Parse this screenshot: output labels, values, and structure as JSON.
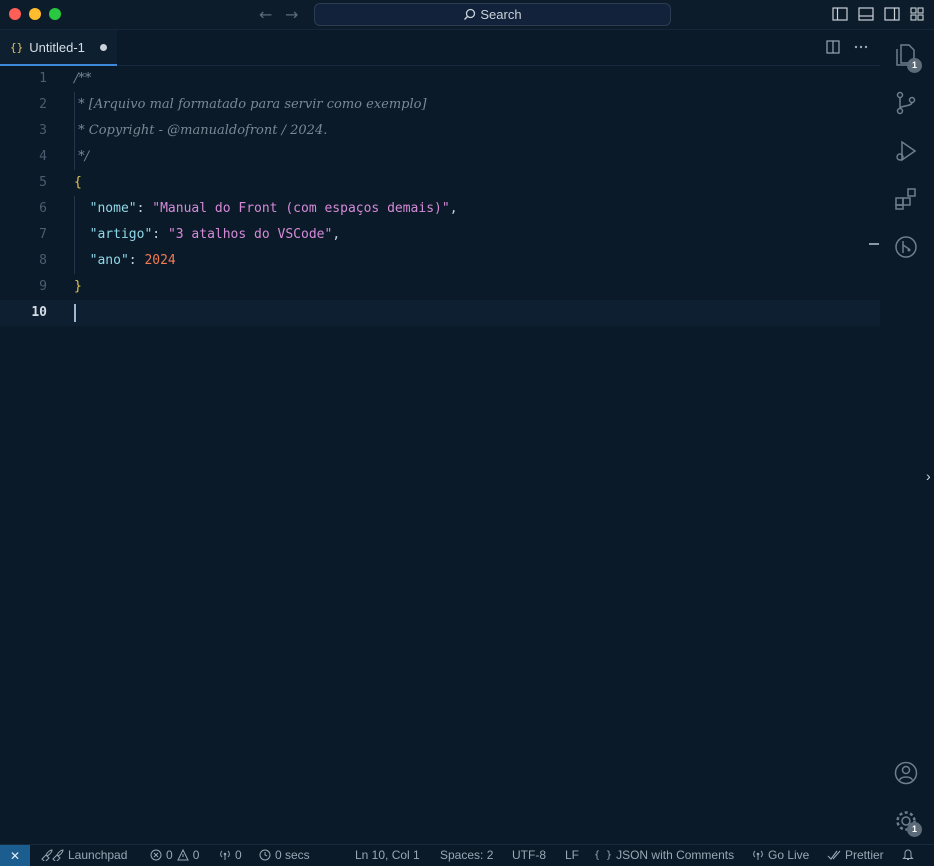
{
  "window": {
    "search_label": "Search"
  },
  "tabs": [
    {
      "icon": "{}",
      "label": "Untitled-1",
      "modified": true
    }
  ],
  "editor": {
    "lines": [
      {
        "number": "1",
        "tokens": [
          {
            "t": "comment",
            "v": "/**"
          }
        ]
      },
      {
        "number": "2",
        "tokens": [
          {
            "t": "comment",
            "v": " * [Arquivo mal formatado para servir como exemplo]"
          }
        ]
      },
      {
        "number": "3",
        "tokens": [
          {
            "t": "comment",
            "v": " * Copyright - @manualdofront / 2024."
          }
        ]
      },
      {
        "number": "4",
        "tokens": [
          {
            "t": "comment",
            "v": " */"
          }
        ]
      },
      {
        "number": "5",
        "tokens": [
          {
            "t": "brace",
            "v": "{"
          }
        ]
      },
      {
        "number": "6",
        "tokens": [
          {
            "t": "punct",
            "v": "  "
          },
          {
            "t": "key",
            "v": "\"nome\""
          },
          {
            "t": "punct",
            "v": ": "
          },
          {
            "t": "string",
            "v": "\"Manual do Front (com espaços demais)\""
          },
          {
            "t": "punct",
            "v": ","
          }
        ]
      },
      {
        "number": "7",
        "tokens": [
          {
            "t": "punct",
            "v": "  "
          },
          {
            "t": "key",
            "v": "\"artigo\""
          },
          {
            "t": "punct",
            "v": ": "
          },
          {
            "t": "string",
            "v": "\"3 atalhos do VSCode\""
          },
          {
            "t": "punct",
            "v": ","
          }
        ]
      },
      {
        "number": "8",
        "tokens": [
          {
            "t": "punct",
            "v": "  "
          },
          {
            "t": "key",
            "v": "\"ano\""
          },
          {
            "t": "punct",
            "v": ": "
          },
          {
            "t": "number",
            "v": "2024"
          }
        ]
      },
      {
        "number": "9",
        "tokens": [
          {
            "t": "brace",
            "v": "}"
          }
        ]
      },
      {
        "number": "10",
        "tokens": [],
        "active": true
      }
    ]
  },
  "activity_bar": {
    "explorer_badge": "1",
    "settings_badge": "1"
  },
  "status_bar": {
    "launchpad": "Launchpad",
    "errors": "0",
    "warnings": "0",
    "ports": "0",
    "timer": "0 secs",
    "cursor_position": "Ln 10, Col 1",
    "indentation": "Spaces: 2",
    "encoding": "UTF-8",
    "eol": "LF",
    "language": "JSON with Comments",
    "go_live": "Go Live",
    "prettier": "Prettier"
  },
  "colors": {
    "background": "#0b1a28",
    "tab_active_border": "#3d8bd8",
    "key": "#8fd7e8",
    "string": "#d58ad8",
    "number": "#f07c54",
    "brace": "#e6c35c",
    "comment": "#7a8896"
  },
  "icons": {
    "explorer": "files-icon",
    "source_control": "source-control-icon",
    "run_debug": "run-debug-icon",
    "extensions": "extensions-icon",
    "git_graph": "git-graph-icon",
    "account": "account-icon",
    "settings": "gear-icon"
  }
}
